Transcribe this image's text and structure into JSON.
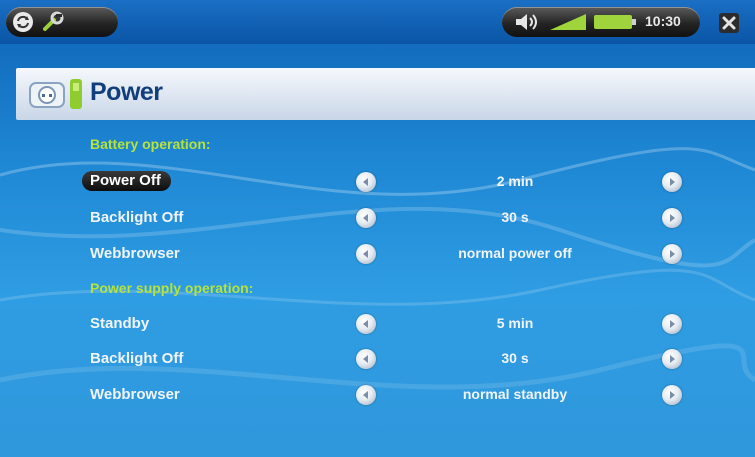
{
  "status_bar": {
    "clock": "10:30",
    "left_icons": [
      "refresh-icon",
      "tools-icon"
    ],
    "right_icons": [
      "speaker-icon",
      "signal-icon",
      "battery-icon",
      "close-icon"
    ]
  },
  "page": {
    "title": "Power",
    "title_icon": "power-plug-icon"
  },
  "sections": [
    {
      "heading": "Battery operation:",
      "rows": [
        {
          "label": "Power Off",
          "value": "2 min",
          "selected": true
        },
        {
          "label": "Backlight Off",
          "value": "30 s",
          "selected": false
        },
        {
          "label": "Webbrowser",
          "value": "normal power off",
          "selected": false
        }
      ]
    },
    {
      "heading": "Power supply operation:",
      "rows": [
        {
          "label": "Standby",
          "value": "5 min",
          "selected": false
        },
        {
          "label": "Backlight Off",
          "value": "30 s",
          "selected": false
        },
        {
          "label": "Webbrowser",
          "value": "normal standby",
          "selected": false
        }
      ]
    }
  ],
  "colors": {
    "background": "#1e87d4",
    "section_heading": "#b6e33a",
    "title_text": "#113f7d",
    "row_text": "#f1f5fb"
  }
}
